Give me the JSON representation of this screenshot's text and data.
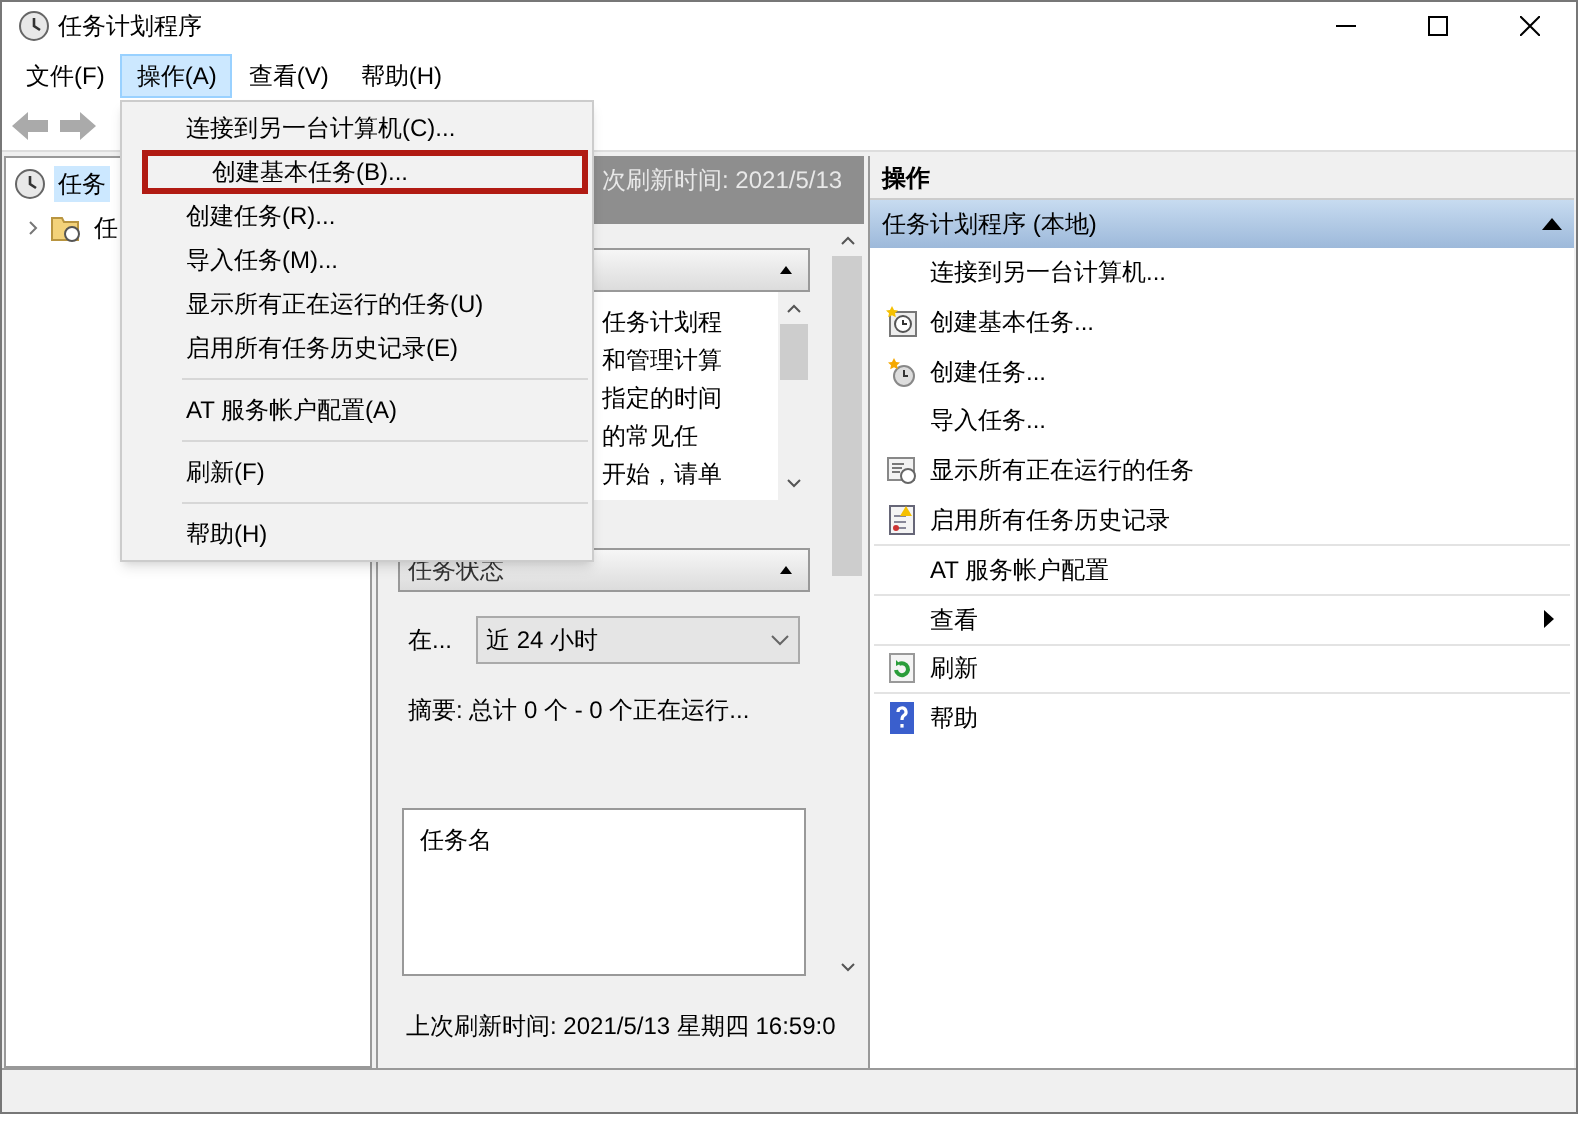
{
  "window": {
    "title": "任务计划程序"
  },
  "menu_bar": [
    {
      "label": "文件(F)",
      "selected": false
    },
    {
      "label": "操作(A)",
      "selected": true
    },
    {
      "label": "查看(V)",
      "selected": false
    },
    {
      "label": "帮助(H)",
      "selected": false
    }
  ],
  "dropdown": [
    {
      "label": "连接到另一台计算机(C)...",
      "divider_above": false,
      "highlighted": false
    },
    {
      "label": "创建基本任务(B)...",
      "divider_above": false,
      "highlighted": true
    },
    {
      "label": "创建任务(R)...",
      "divider_above": false,
      "highlighted": false
    },
    {
      "label": "导入任务(M)...",
      "divider_above": false,
      "highlighted": false
    },
    {
      "label": "显示所有正在运行的任务(U)",
      "divider_above": false,
      "highlighted": false
    },
    {
      "label": "启用所有任务历史记录(E)",
      "divider_above": false,
      "highlighted": false
    },
    {
      "label": "AT 服务帐户配置(A)",
      "divider_above": true,
      "highlighted": false
    },
    {
      "label": "刷新(F)",
      "divider_above": true,
      "highlighted": false
    },
    {
      "label": "帮助(H)",
      "divider_above": true,
      "highlighted": false
    }
  ],
  "tree": [
    {
      "label": "任务",
      "selected": true,
      "children": [
        {
          "label": "任",
          "selected": false,
          "expanded": false
        }
      ]
    }
  ],
  "center": {
    "header": "次刷新时间: 2021/5/13",
    "overview_lines": [
      "任务计划程",
      "和管理计算",
      "指定的时间",
      "的常见任",
      "开始，请单"
    ],
    "status_section": {
      "title": "任务状态",
      "filter_label": "在...",
      "filter_value": "近 24 小时",
      "summary": "摘要: 总计 0 个 - 0 个正在运行...",
      "list_header": "任务名"
    },
    "footer": "上次刷新时间: 2021/5/13 星期四 16:59:0"
  },
  "actions": {
    "title": "操作",
    "group": "任务计划程序 (本地)",
    "expanded": true,
    "items": [
      {
        "label": "连接到另一台计算机...",
        "divider_above": false,
        "submenu": false
      },
      {
        "label": "创建基本任务...",
        "divider_above": false,
        "submenu": false
      },
      {
        "label": "创建任务...",
        "divider_above": false,
        "submenu": false
      },
      {
        "label": "导入任务...",
        "divider_above": false,
        "submenu": false
      },
      {
        "label": "显示所有正在运行的任务",
        "divider_above": false,
        "submenu": false
      },
      {
        "label": "启用所有任务历史记录",
        "divider_above": false,
        "submenu": false
      },
      {
        "label": "AT 服务帐户配置",
        "divider_above": true,
        "submenu": false
      },
      {
        "label": "查看",
        "divider_above": true,
        "submenu": true
      },
      {
        "label": "刷新",
        "divider_above": true,
        "submenu": false
      },
      {
        "label": "帮助",
        "divider_above": true,
        "submenu": false
      }
    ]
  }
}
